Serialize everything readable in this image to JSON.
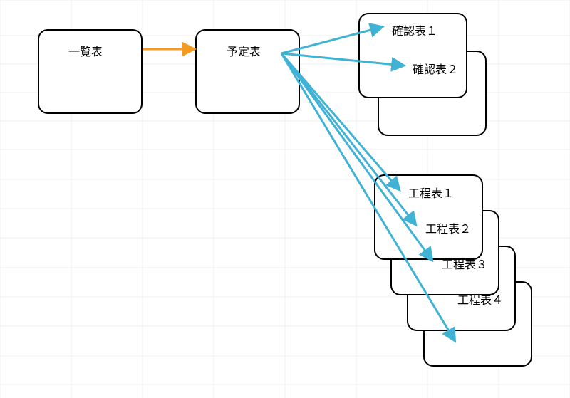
{
  "colors": {
    "orange": "#f39b1f",
    "blue": "#3fb2d6",
    "border": "#000000",
    "grid": "#e9e9e9"
  },
  "nodes": {
    "list": {
      "label": "一覧表"
    },
    "schedule": {
      "label": "予定表"
    },
    "confirm1": {
      "label": "確認表１"
    },
    "confirm2": {
      "label": "確認表２"
    },
    "process1": {
      "label": "工程表１"
    },
    "process2": {
      "label": "工程表２"
    },
    "process3": {
      "label": "工程表３"
    },
    "process4": {
      "label": "工程表４"
    }
  }
}
